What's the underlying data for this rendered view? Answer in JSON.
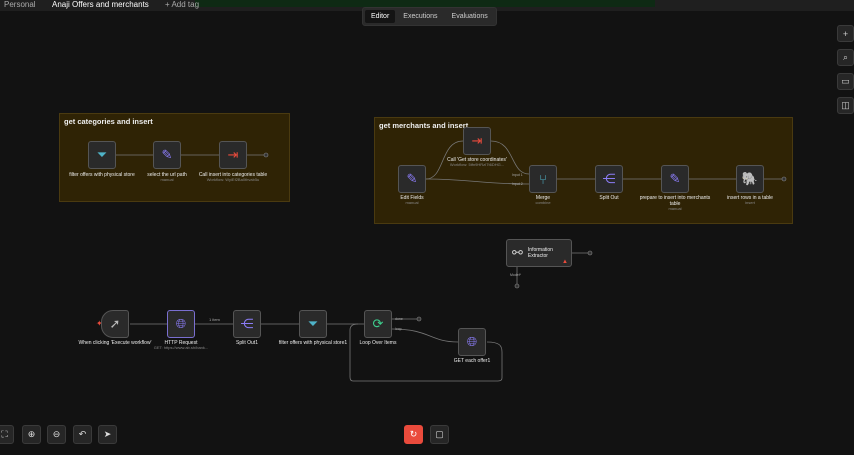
{
  "header": {
    "breadcrumb_root": "Personal",
    "workflow_name": "Anaji Offers and merchants",
    "add_tag": "+ Add tag"
  },
  "tabs": [
    {
      "label": "Editor",
      "active": true
    },
    {
      "label": "Executions"
    },
    {
      "label": "Evaluations"
    }
  ],
  "groups": [
    {
      "title": "get categories and insert"
    },
    {
      "title": "get merchants and insert"
    }
  ],
  "nodes": {
    "g1_filter": {
      "name": "filter offers with physical store",
      "icon": "filter-icon"
    },
    "g1_set": {
      "name": "select the url path",
      "sub": "manual",
      "icon": "pencil-icon"
    },
    "g1_call": {
      "name": "Call insert into categories table",
      "sub": "Workflow: WyiEf2Ba0thvab5u",
      "icon": "sign-in-icon"
    },
    "g2_edit": {
      "name": "Edit Fields",
      "sub": "manual",
      "icon": "pencil-icon"
    },
    "g2_call": {
      "name": "Call 'Get store coordinates'",
      "sub": "Workflow: 5tfn9HRzI7t6DHG...",
      "icon": "sign-in-icon"
    },
    "g2_merge": {
      "name": "Merge",
      "sub": "combine",
      "icon": "merge-icon",
      "inputs": [
        "Input 1",
        "Input 2"
      ]
    },
    "g2_split": {
      "name": "Split Out",
      "icon": "split-icon"
    },
    "g2_prepare": {
      "name": "prepare to insert into merchants table",
      "sub": "manual",
      "icon": "pencil-icon"
    },
    "g2_insert": {
      "name": "insert rows in a table",
      "sub": "insert",
      "icon": "postgres-icon"
    },
    "info": {
      "name": "Information Extractor",
      "port": "Model*",
      "icon": "extractor-icon"
    },
    "trigger": {
      "name": "When clicking 'Execute workflow'",
      "icon": "cursor-icon"
    },
    "http": {
      "name": "HTTP Request",
      "sub": "GET: https://www.ab.sh/bank...",
      "icon": "globe-icon",
      "edge_label": "1 item"
    },
    "split1": {
      "name": "Split Out1",
      "icon": "split-icon"
    },
    "filter1": {
      "name": "filter offers with physical store1",
      "icon": "filter-icon"
    },
    "loop": {
      "name": "Loop Over Items",
      "icon": "refresh-icon",
      "outputs": [
        "done",
        "loop"
      ]
    },
    "get": {
      "name": "GET each offer1",
      "icon": "globe-icon"
    }
  },
  "colors": {
    "canvas": "#121212",
    "group": "#2f2305",
    "accent_red": "#ea4b3c",
    "purple": "#8b7cf6",
    "teal": "#4fb3c8"
  }
}
